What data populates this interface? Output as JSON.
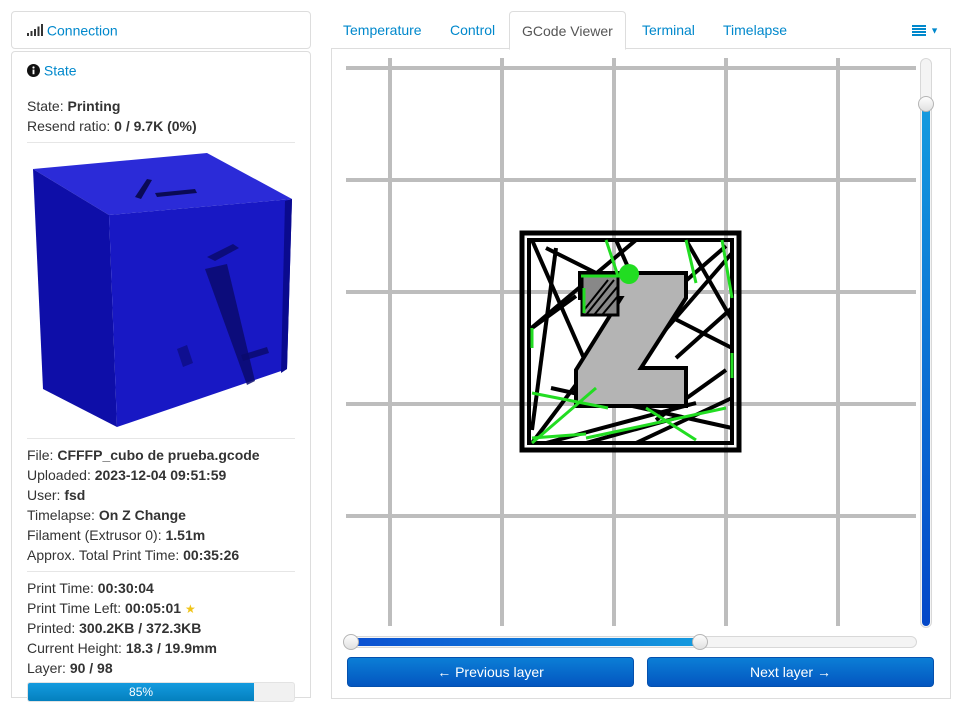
{
  "sidebar": {
    "connection_label": "Connection",
    "state_label": "State",
    "state": {
      "state_key": "State:",
      "state_value": "Printing",
      "resend_key": "Resend ratio:",
      "resend_value": "0 / 9.7K (0%)"
    },
    "file": {
      "file_key": "File:",
      "file_value": "CFFFP_cubo de prueba.gcode",
      "uploaded_key": "Uploaded:",
      "uploaded_value": "2023-12-04 09:51:59",
      "user_key": "User:",
      "user_value": "fsd",
      "timelapse_key": "Timelapse:",
      "timelapse_value": "On Z Change",
      "filament_key": "Filament (Extrusor 0):",
      "filament_value": "1.51m",
      "total_key": "Approx. Total Print Time:",
      "total_value": "00:35:26"
    },
    "progress": {
      "print_time_key": "Print Time:",
      "print_time_value": "00:30:04",
      "time_left_key": "Print Time Left:",
      "time_left_value": "00:05:01",
      "printed_key": "Printed:",
      "printed_value": "300.2KB / 372.3KB",
      "height_key": "Current Height:",
      "height_value": "18.3 / 19.9mm",
      "layer_key": "Layer:",
      "layer_value": "90 / 98",
      "percent_label": "85%",
      "percent": 85
    }
  },
  "tabs": [
    {
      "label": "Temperature"
    },
    {
      "label": "Control"
    },
    {
      "label": "GCode Viewer",
      "active": true
    },
    {
      "label": "Terminal"
    },
    {
      "label": "Timelapse"
    }
  ],
  "viewer": {
    "layer_slider_fraction": 0.92,
    "progress_slider_fraction": 0.62,
    "prev_label": "Previous layer",
    "next_label": "Next layer"
  },
  "colors": {
    "accent": "#0088cc",
    "cube": "#1515c8",
    "travel": "#22dd22"
  }
}
